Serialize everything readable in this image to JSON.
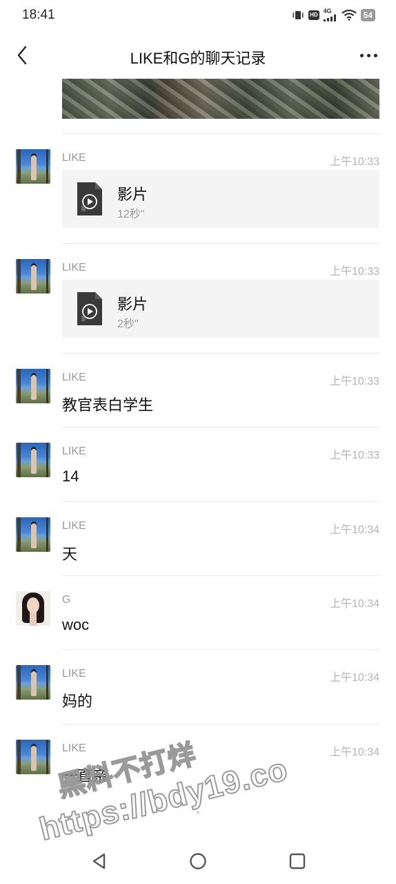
{
  "status_bar": {
    "time": "18:41",
    "hd_label": "HD",
    "network_label": "4G",
    "battery": "54"
  },
  "nav": {
    "title": "LIKE和G的聊天记录"
  },
  "messages": [
    {
      "sender": "LIKE",
      "time": "上午10:33",
      "type": "file",
      "file_name": "影片",
      "file_meta": "12秒\""
    },
    {
      "sender": "LIKE",
      "time": "上午10:33",
      "type": "file",
      "file_name": "影片",
      "file_meta": "2秒\""
    },
    {
      "sender": "LIKE",
      "time": "上午10:33",
      "type": "text",
      "text": "教官表白学生"
    },
    {
      "sender": "LIKE",
      "time": "上午10:33",
      "type": "text",
      "text": "14"
    },
    {
      "sender": "LIKE",
      "time": "上午10:34",
      "type": "text",
      "text": "天"
    },
    {
      "sender": "G",
      "time": "上午10:34",
      "type": "text",
      "text": "woc"
    },
    {
      "sender": "LIKE",
      "time": "上午10:34",
      "type": "text",
      "text": "妈的"
    },
    {
      "sender": "LIKE",
      "time": "上午10:34",
      "type": "text",
      "text": "一直亲"
    }
  ],
  "watermark": {
    "line1": "黑料不打烊",
    "line2": "https://bdy19.co"
  },
  "icons": {
    "back": "chevron-left-icon",
    "more": "more-dots-icon",
    "video_file": "video-file-icon",
    "sys_back": "triangle-back-icon",
    "sys_home": "circle-home-icon",
    "sys_recent": "square-recent-icon"
  }
}
